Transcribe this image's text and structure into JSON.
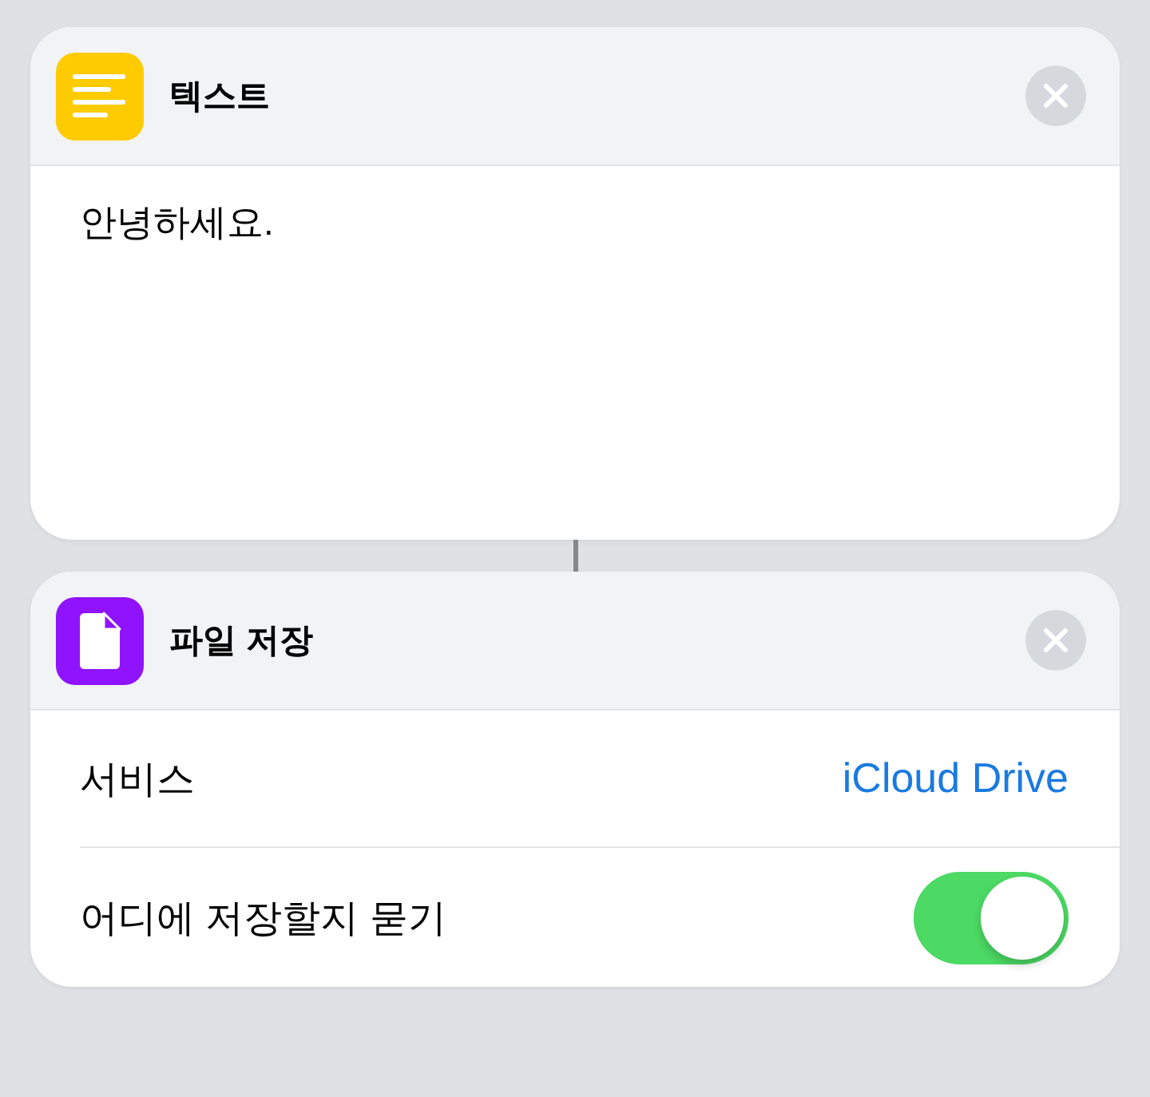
{
  "actions": [
    {
      "kind": "text",
      "title": "텍스트",
      "content": "안녕하세요."
    },
    {
      "kind": "save_file",
      "title": "파일 저장",
      "settings": [
        {
          "kind": "value",
          "label": "서비스",
          "value": "iCloud Drive"
        },
        {
          "kind": "toggle",
          "label": "어디에 저장할지 묻기",
          "on": true
        }
      ]
    }
  ]
}
